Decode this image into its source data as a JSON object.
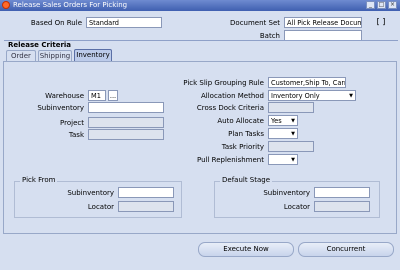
{
  "window": {
    "title": "Release Sales Orders For Picking"
  },
  "header": {
    "based_on_rule_label": "Based On Rule",
    "based_on_rule_value": "Standard",
    "document_set_label": "Document Set",
    "document_set_value": "All Pick Release Docum",
    "batch_label": "Batch",
    "batch_value": "",
    "bracket_control": "[ ]"
  },
  "section": {
    "title": "Release Criteria"
  },
  "tabs": [
    {
      "label": "Order"
    },
    {
      "label": "Shipping"
    },
    {
      "label": "Inventory"
    }
  ],
  "left_fields": {
    "warehouse_label": "Warehouse",
    "warehouse_value": "M1",
    "subinventory_label": "Subinventory",
    "subinventory_value": "",
    "project_label": "Project",
    "project_value": "",
    "task_label": "Task",
    "task_value": ""
  },
  "right_fields": {
    "grouping_label": "Pick Slip Grouping Rule",
    "grouping_value": "Customer,Ship To, Carri",
    "allocation_label": "Allocation Method",
    "allocation_value": "Inventory Only",
    "crossdock_label": "Cross Dock Criteria",
    "crossdock_value": "",
    "auto_allocate_label": "Auto Allocate",
    "auto_allocate_value": "Yes",
    "plan_tasks_label": "Plan Tasks",
    "plan_tasks_value": "",
    "task_priority_label": "Task Priority",
    "task_priority_value": "",
    "pull_replenishment_label": "Pull Replenishment",
    "pull_replenishment_value": ""
  },
  "pick_from": {
    "title": "Pick From",
    "subinventory_label": "Subinventory",
    "subinventory_value": "",
    "locator_label": "Locator",
    "locator_value": ""
  },
  "default_stage": {
    "title": "Default Stage",
    "subinventory_label": "Subinventory",
    "subinventory_value": "",
    "locator_label": "Locator",
    "locator_value": ""
  },
  "buttons": {
    "execute_now": "Execute Now",
    "concurrent": "Concurrent"
  },
  "icons": {
    "app": "oracle-app-icon",
    "dropdown": "▼",
    "ellipsis": "..."
  }
}
